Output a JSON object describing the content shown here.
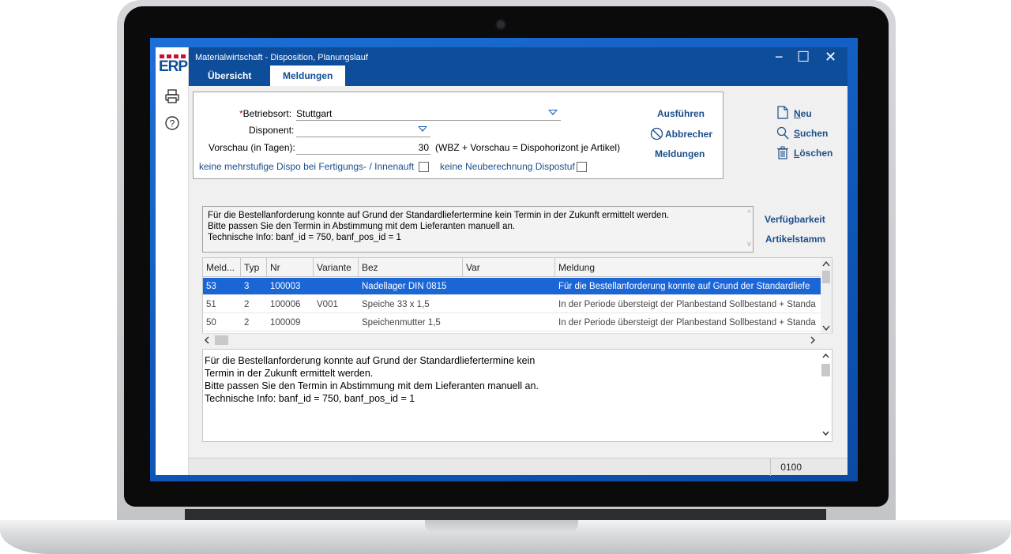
{
  "window": {
    "title": "Materialwirtschaft - Disposition,  Planungslauf",
    "tabs": [
      {
        "label": "Übersicht",
        "active": false
      },
      {
        "label": "Meldungen",
        "active": true
      }
    ],
    "controls": {
      "minimize": "−",
      "maximize": "☐",
      "close": "✕"
    }
  },
  "logo": {
    "text": "ERP",
    "accent_color": "#c8102e",
    "brand_color": "#0e4d99"
  },
  "rail": {
    "icons": [
      "printer-icon",
      "help-icon"
    ]
  },
  "form": {
    "betriebsort": {
      "label": "Betriebsort:",
      "value": "Stuttgart",
      "required": true
    },
    "disponent": {
      "label": "Disponent:",
      "value": ""
    },
    "vorschau": {
      "label": "Vorschau (in Tagen):",
      "value": "30",
      "hint": "(WBZ + Vorschau = Dispohorizont je Artikel)"
    },
    "checkbox_dispo": {
      "label": "keine mehrstufige Dispo bei Fertigungs- / Innenauft",
      "checked": false
    },
    "checkbox_neuberechnung": {
      "label": "keine Neuberechnung Dispostuf",
      "checked": false
    }
  },
  "actions": {
    "ausfuehren": "Ausführen",
    "abbrecher": "Abbrecher",
    "meldungen": "Meldungen"
  },
  "side_buttons": {
    "neu": {
      "u": "N",
      "rest": "eu"
    },
    "suchen": {
      "u": "S",
      "rest": "uchen"
    },
    "loeschen": {
      "u": "L",
      "rest": "öschen"
    },
    "verfuegbarkeit": "Verfügbarkeit",
    "artikelstamm": "Artikelstamm"
  },
  "info": {
    "lines": [
      "Für die Bestellanforderung konnte auf Grund der Standardliefertermine kein Termin in der Zukunft ermittelt werden.",
      "Bitte passen Sie den Termin in Abstimmung mit dem Lieferanten manuell an.",
      "Technische Info: banf_id = 750, banf_pos_id = 1"
    ]
  },
  "grid": {
    "columns": [
      "Meld...",
      "Typ",
      "Nr",
      "Variante",
      "Bez",
      "Var",
      "Meldung"
    ],
    "rows": [
      {
        "meld": "53",
        "typ": "3",
        "nr": "100003",
        "variante": "",
        "bez": "Nadellager DIN 0815",
        "var": "",
        "meldung": "Für die Bestellanforderung konnte auf Grund der Standardliefe",
        "selected": true
      },
      {
        "meld": "51",
        "typ": "2",
        "nr": "100006",
        "variante": "V001",
        "bez": "Speiche 33 x 1,5",
        "var": "",
        "meldung": "In der Periode übersteigt der Planbestand Sollbestand + Standa",
        "selected": false
      },
      {
        "meld": "50",
        "typ": "2",
        "nr": "100009",
        "variante": "",
        "bez": "Speichenmutter 1,5",
        "var": "",
        "meldung": "In der Periode übersteigt der Planbestand Sollbestand + Standa",
        "selected": false
      }
    ]
  },
  "detail": {
    "lines": [
      "Für die Bestellanforderung konnte auf Grund der Standardliefertermine kein",
      "Termin in der Zukunft ermittelt werden.",
      "Bitte passen Sie den Termin in Abstimmung mit dem Lieferanten manuell an.",
      "Technische Info: banf_id = 750, banf_pos_id = 1"
    ]
  },
  "status": {
    "code": "0100"
  },
  "colors": {
    "selection": "#1a66d6",
    "titlebar": "#0e4d99",
    "link": "#1b4e8a"
  }
}
